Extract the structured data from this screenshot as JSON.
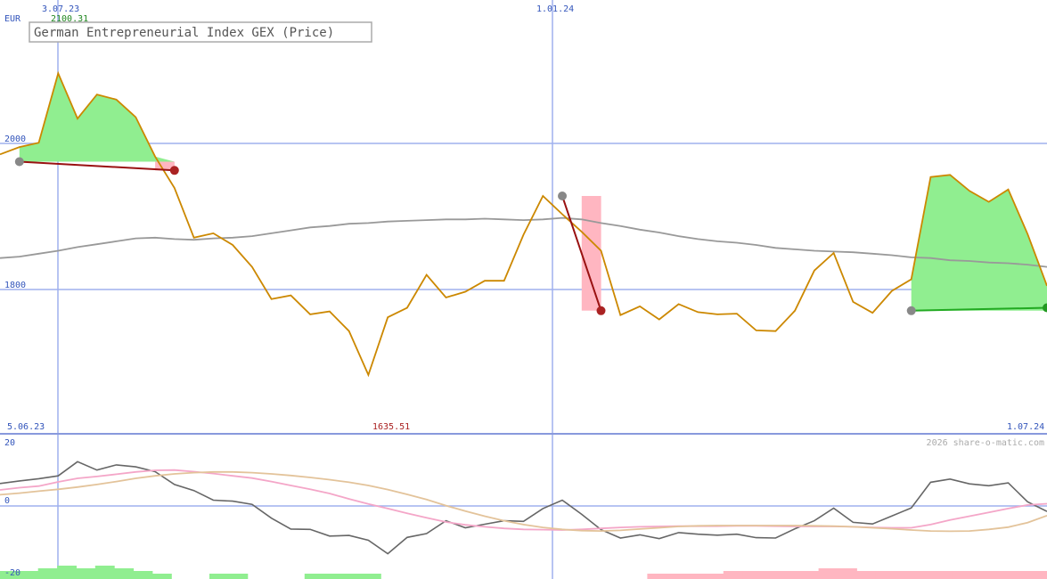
{
  "page": {
    "title": "German Entrepreneurial Index GEX (Price)",
    "currency": "EUR",
    "watermark": "2026 share-o-matic.com"
  },
  "labels": {
    "top_date_left": "3.07.23",
    "top_value_left": "2100.31",
    "top_date_mid": "1.01.24",
    "bottom_date_left": "5.06.23",
    "bottom_value_mid": "1635.51",
    "bottom_date_right": "1.07.24"
  },
  "colors": {
    "price": "#cc8800",
    "moving_average": "#999999",
    "grid": "#aabbee",
    "axis": "#8899dd",
    "gain_fill": "#90ee90",
    "loss_fill": "#ffb6c1",
    "gain_line": "#22aa22",
    "loss_line": "#991111",
    "tick_blue": "#3355bb",
    "tick_red": "#aa2222",
    "tick_green": "#228822"
  },
  "chart_data": [
    {
      "type": "line",
      "title": "German Entrepreneurial Index GEX (Price)",
      "ylabel": "EUR",
      "y_ticks": [
        {
          "value": 2000,
          "label": "2000"
        },
        {
          "value": 1800,
          "label": "1800"
        }
      ],
      "x_ticks": [
        "3.07.23",
        "1.01.24"
      ],
      "x_range": [
        "5.06.23",
        "1.07.24"
      ],
      "ylim": [
        1600,
        2200
      ],
      "max_point": {
        "date": "3.07.23",
        "value": 2100.31
      },
      "min_point": {
        "value": 1635.51
      },
      "series": [
        {
          "type": "line",
          "values": [
            1985,
            1995,
            2001,
            2096,
            2034,
            2067,
            2060,
            2036,
            1982,
            1939,
            1871,
            1877,
            1861,
            1831,
            1787,
            1792,
            1766,
            1770,
            1743,
            1683,
            1762,
            1775,
            1820,
            1789,
            1797,
            1812,
            1812,
            1875,
            1928,
            1903,
            1879,
            1853,
            1765,
            1777,
            1759,
            1780,
            1769,
            1766,
            1767,
            1744,
            1743,
            1771,
            1826,
            1850,
            1783,
            1768,
            1798,
            1814,
            1954,
            1957,
            1935,
            1920,
            1937,
            1876,
            1805
          ]
        },
        {
          "type": "line",
          "values": [
            1843,
            1845,
            1849,
            1853,
            1858,
            1862,
            1866,
            1870,
            1871,
            1869,
            1868,
            1870,
            1871,
            1873,
            1877,
            1881,
            1885,
            1887,
            1890,
            1891,
            1893,
            1894,
            1895,
            1896,
            1896,
            1897,
            1896,
            1895,
            1896,
            1898,
            1896,
            1891,
            1887,
            1882,
            1878,
            1873,
            1869,
            1866,
            1864,
            1861,
            1857,
            1855,
            1853,
            1852,
            1851,
            1849,
            1847,
            1844,
            1843,
            1840,
            1839,
            1837,
            1836,
            1834,
            1831
          ]
        }
      ],
      "trades": [
        {
          "result": "loss",
          "entry_value": 1975,
          "exit_value": 1963
        },
        {
          "result": "loss",
          "entry_value": 1928,
          "exit_value": 1771
        },
        {
          "result": "gain",
          "entry_value": 1771,
          "exit_value": 1775
        }
      ]
    },
    {
      "type": "line",
      "y_ticks": [
        {
          "value": 20,
          "label": "20"
        },
        {
          "value": 0,
          "label": "0"
        },
        {
          "value": -20,
          "label": "-20"
        }
      ],
      "ylim": [
        -20,
        20
      ],
      "series": [
        {
          "type": "line",
          "values": [
            7,
            7.8,
            8.5,
            9.4,
            13.8,
            11.2,
            12.8,
            12.2,
            10.7,
            6.7,
            4.8,
            1.8,
            1.5,
            0.5,
            -3.8,
            -7.2,
            -7.3,
            -9.4,
            -9.2,
            -10.7,
            -14.9,
            -9.8,
            -8.6,
            -4.6,
            -6.8,
            -5.7,
            -4.6,
            -4.8,
            -0.8,
            1.8,
            -2.6,
            -7.4,
            -10,
            -9,
            -10.2,
            -8.3,
            -8.8,
            -9.1,
            -8.8,
            -9.9,
            -10,
            -7.1,
            -4.6,
            -0.7,
            -5.1,
            -5.6,
            -3.1,
            -0.6,
            7.4,
            8.4,
            6.9,
            6.3,
            7.2,
            1.3,
            -1.7
          ]
        },
        {
          "type": "line",
          "values": [
            5,
            5.7,
            6.2,
            7.5,
            8.6,
            9.2,
            9.9,
            10.6,
            11.1,
            11.2,
            10.7,
            10.1,
            9.4,
            8.7,
            7.6,
            6.4,
            5.2,
            3.9,
            2.2,
            0.6,
            -0.8,
            -2.3,
            -3.7,
            -5,
            -5.9,
            -6.5,
            -7,
            -7.3,
            -7.4,
            -7.5,
            -7.3,
            -7,
            -6.7,
            -6.5,
            -6.4,
            -6.3,
            -6.3,
            -6.3,
            -6.2,
            -6.2,
            -6.3,
            -6.4,
            -6.4,
            -6.4,
            -6.5,
            -6.7,
            -6.8,
            -6.8,
            -5.8,
            -4.4,
            -3.2,
            -2,
            -0.8,
            0.3,
            0.7
          ]
        },
        {
          "type": "line",
          "values": [
            3.5,
            4,
            4.6,
            5.2,
            5.9,
            6.7,
            7.6,
            8.6,
            9.4,
            10,
            10.4,
            10.6,
            10.6,
            10.4,
            10,
            9.5,
            8.9,
            8.2,
            7.4,
            6.4,
            5.1,
            3.6,
            2,
            0.1,
            -1.6,
            -3.2,
            -4.6,
            -5.8,
            -6.7,
            -7.3,
            -7.7,
            -7.8,
            -7.6,
            -7.2,
            -6.8,
            -6.4,
            -6.2,
            -6.1,
            -6.1,
            -6.1,
            -6.1,
            -6.1,
            -6.2,
            -6.3,
            -6.5,
            -6.8,
            -7.1,
            -7.5,
            -7.8,
            -7.9,
            -7.8,
            -7.3,
            -6.6,
            -5.2,
            -3
          ]
        }
      ],
      "volume_bars": {
        "gain_values": [
          3,
          3,
          4,
          5,
          4,
          5,
          4,
          3,
          2,
          0,
          0,
          2,
          2,
          0,
          0,
          0,
          2,
          2,
          2,
          2
        ],
        "loss_values": [
          0,
          0,
          0,
          0,
          0,
          0,
          0,
          0,
          0,
          0,
          0,
          0,
          0,
          0,
          0,
          0,
          0,
          0,
          0,
          0,
          0,
          0,
          0,
          0,
          0,
          0,
          0,
          0,
          0,
          0,
          0,
          0,
          0,
          0,
          2,
          2,
          2,
          2,
          3,
          3,
          3,
          3,
          3,
          4,
          4,
          3,
          3,
          3,
          3,
          3,
          3,
          3,
          3,
          3,
          3
        ]
      }
    }
  ]
}
